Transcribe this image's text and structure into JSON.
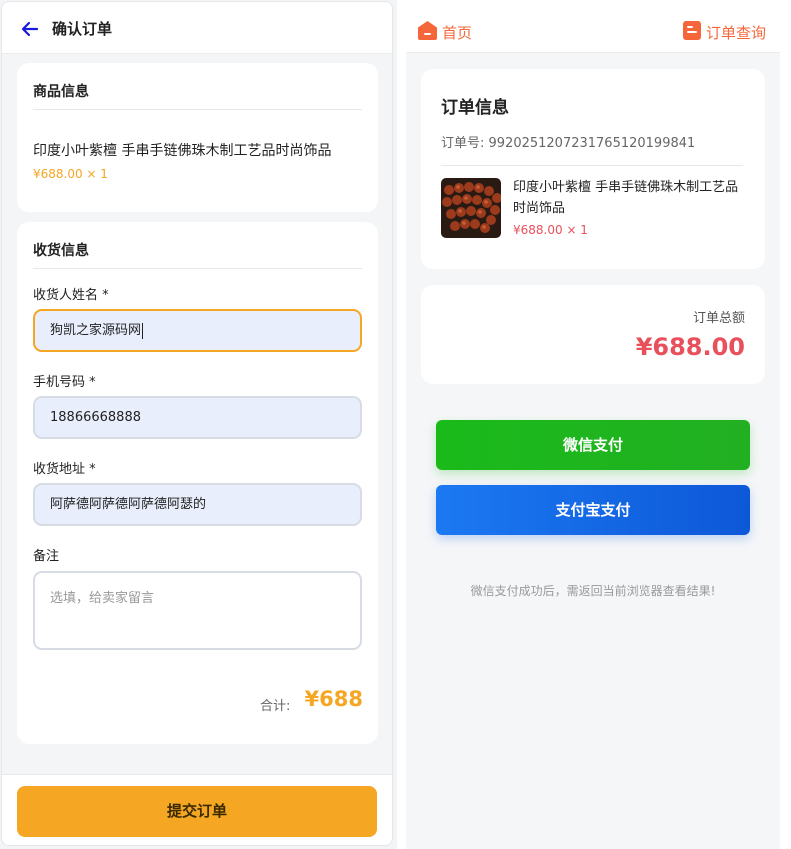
{
  "checkout": {
    "title": "确认订单",
    "product_section": {
      "title": "商品信息",
      "product_name": "印度小叶紫檀 手串手链佛珠木制工艺品时尚饰品",
      "price_qty": "¥688.00 × 1"
    },
    "address_section": {
      "title": "收货信息",
      "name_label": "收货人姓名 *",
      "name_value": "狗凯之家源码网",
      "phone_label": "手机号码 *",
      "phone_value": "18866668888",
      "address_label": "收货地址 *",
      "address_value": "阿萨德阿萨德阿萨德阿瑟的",
      "remark_label": "备注",
      "remark_placeholder": "选填，给卖家留言",
      "total_label": "合计:",
      "total_value": "¥688"
    },
    "submit_label": "提交订单"
  },
  "payment": {
    "nav": {
      "home_label": "首页",
      "order_query_label": "订单查询"
    },
    "order_info": {
      "title": "订单信息",
      "order_no": "订单号: 992025120723176512019984​1",
      "product_name": "印度小叶紫檀 手串手链佛珠木制工艺品时尚饰品",
      "price_qty": "¥688.00 × 1"
    },
    "total": {
      "label": "订单总额",
      "value": "¥688.00"
    },
    "wechat_pay_label": "微信支付",
    "alipay_label": "支付宝支付",
    "note": "微信支付成功后，需返回当前浏览器查看结果!"
  },
  "colors": {
    "accent_orange": "#f5a623",
    "nav_orange": "#f5673a",
    "price_red": "#e8505b",
    "wechat_green": "#1aba1a",
    "alipay_blue": "#1668e8"
  },
  "icons": {
    "back": "arrow-left-icon",
    "home": "home-icon",
    "order_query": "order-list-icon"
  }
}
